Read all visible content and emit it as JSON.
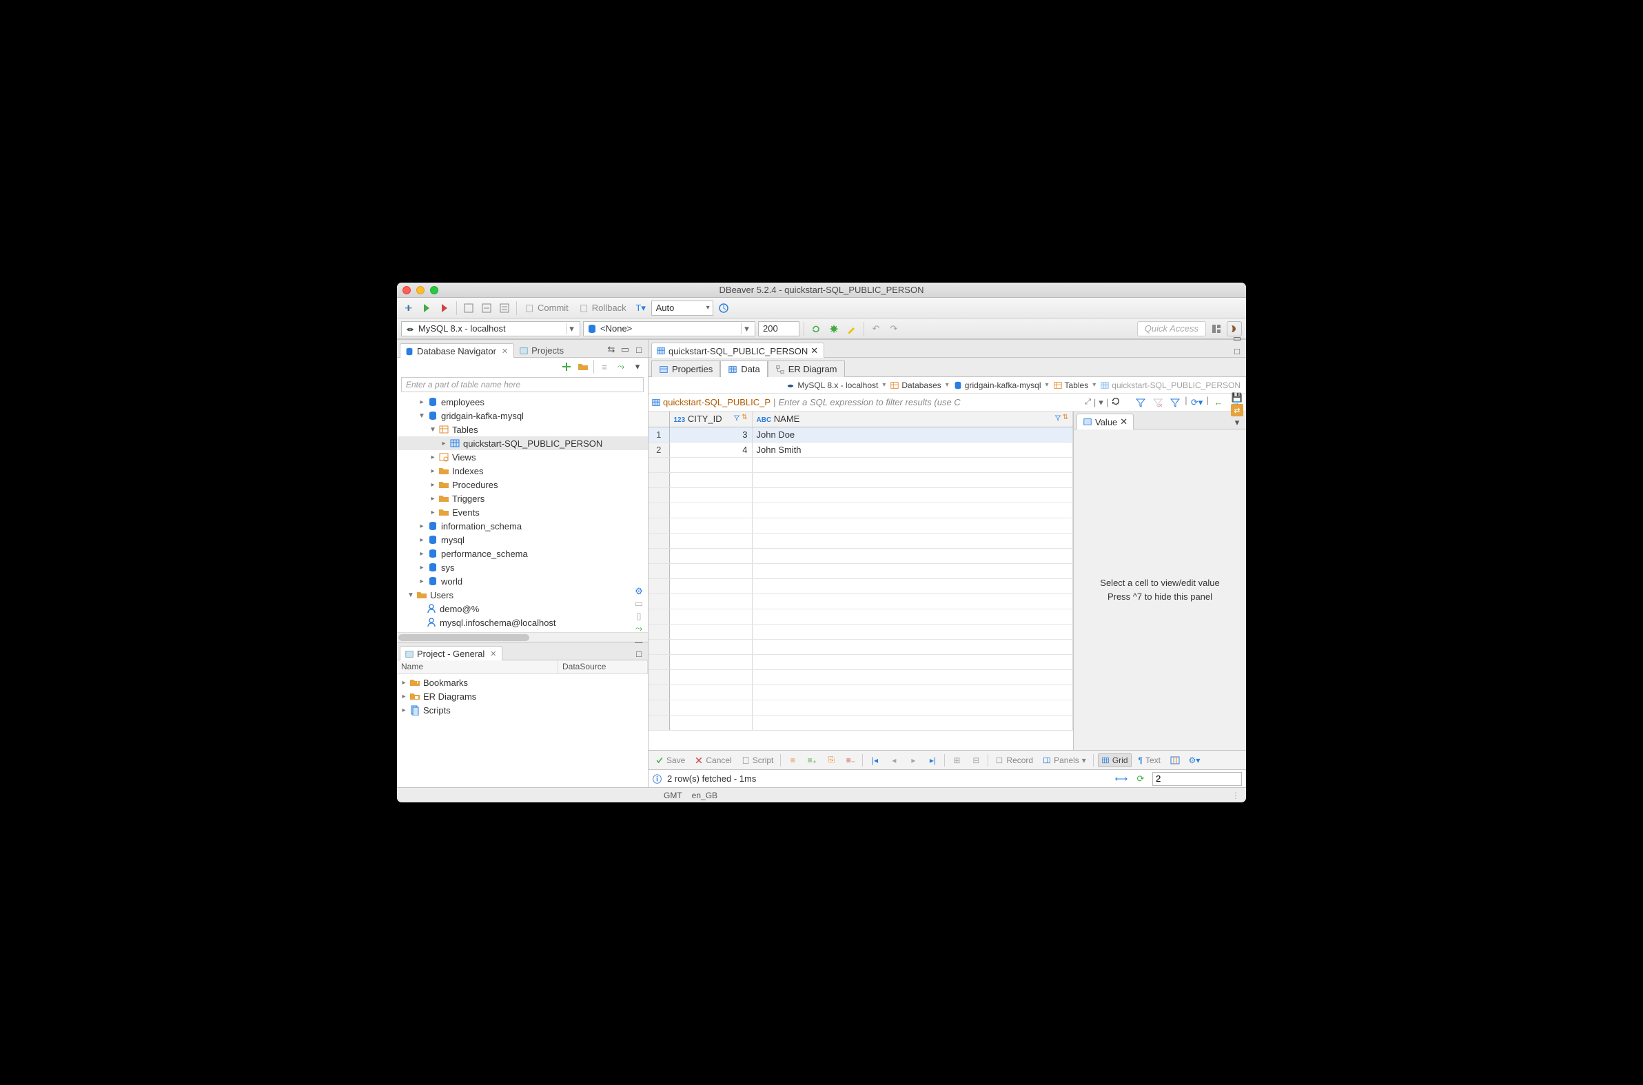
{
  "titlebar": {
    "title": "DBeaver 5.2.4 - quickstart-SQL_PUBLIC_PERSON"
  },
  "toolbar1": {
    "commit": "Commit",
    "rollback": "Rollback",
    "tx_mode": "Auto"
  },
  "toolbar2": {
    "connection": "MySQL 8.x - localhost",
    "schema": "<None>",
    "limit": "200",
    "quick_access": "Quick Access"
  },
  "nav": {
    "tab_navigator": "Database Navigator",
    "tab_projects": "Projects",
    "filter_placeholder": "Enter a part of table name here",
    "tree": {
      "employees": "employees",
      "gridgain": "gridgain-kafka-mysql",
      "tables": "Tables",
      "quickstart": "quickstart-SQL_PUBLIC_PERSON",
      "views": "Views",
      "indexes": "Indexes",
      "procedures": "Procedures",
      "triggers": "Triggers",
      "events": "Events",
      "info_schema": "information_schema",
      "mysql": "mysql",
      "perf_schema": "performance_schema",
      "sys": "sys",
      "world": "world",
      "users": "Users",
      "user1": "demo@%",
      "user2": "mysql.infoschema@localhost"
    }
  },
  "project": {
    "tab": "Project - General",
    "col_name": "Name",
    "col_ds": "DataSource",
    "bookmarks": "Bookmarks",
    "er": "ER Diagrams",
    "scripts": "Scripts"
  },
  "editor": {
    "tab": "quickstart-SQL_PUBLIC_PERSON",
    "sub_properties": "Properties",
    "sub_data": "Data",
    "sub_er": "ER Diagram"
  },
  "crumb": {
    "conn": "MySQL 8.x - localhost",
    "dbs": "Databases",
    "db": "gridgain-kafka-mysql",
    "tables": "Tables",
    "tbl": "quickstart-SQL_PUBLIC_PERSON"
  },
  "filter": {
    "name": "quickstart-SQL_PUBLIC_P",
    "placeholder": "Enter a SQL expression to filter results (use C"
  },
  "grid": {
    "columns": [
      {
        "type": "123",
        "name": "CITY_ID"
      },
      {
        "type": "ABC",
        "name": "NAME"
      }
    ],
    "rows": [
      {
        "n": "1",
        "city_id": "3",
        "name": "John Doe"
      },
      {
        "n": "2",
        "city_id": "4",
        "name": "John Smith"
      }
    ]
  },
  "value_panel": {
    "tab": "Value",
    "msg1": "Select a cell to view/edit value",
    "msg2": "Press ^7 to hide this panel"
  },
  "footer": {
    "save": "Save",
    "cancel": "Cancel",
    "script": "Script",
    "record": "Record",
    "panels": "Panels",
    "grid": "Grid",
    "text": "Text"
  },
  "status": {
    "msg": "2 row(s) fetched - 1ms",
    "refresh_count": "2"
  },
  "bottom": {
    "tz": "GMT",
    "locale": "en_GB"
  }
}
